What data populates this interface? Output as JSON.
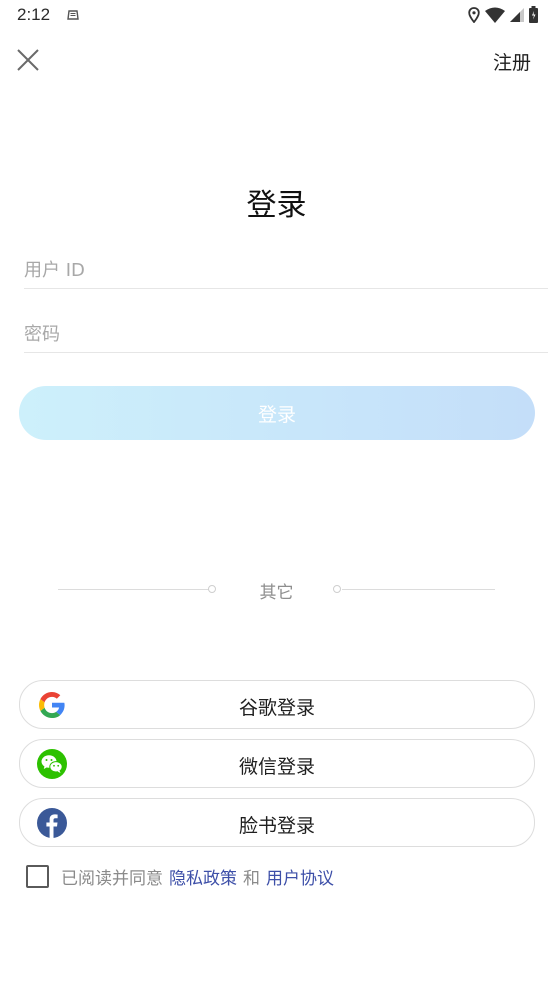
{
  "status_bar": {
    "time": "2:12",
    "icons": [
      "notification-icon",
      "location-icon",
      "wifi-icon",
      "signal-icon",
      "battery-icon"
    ]
  },
  "header": {
    "close_icon": "close-icon",
    "register_label": "注册"
  },
  "form": {
    "title": "登录",
    "userid_placeholder": "用户 ID",
    "userid_value": "",
    "password_placeholder": "密码",
    "password_value": "",
    "login_button_label": "登录"
  },
  "divider": {
    "label": "其它"
  },
  "social_logins": [
    {
      "label": "谷歌登录",
      "icon": "google-icon"
    },
    {
      "label": "微信登录",
      "icon": "wechat-icon"
    },
    {
      "label": "脸书登录",
      "icon": "facebook-icon"
    }
  ],
  "agreement": {
    "checked": false,
    "prefix": "已阅读并同意",
    "privacy_link": "隐私政策",
    "conjunction": "和",
    "terms_link": "用户协议"
  },
  "colors": {
    "login_gradient_start": "#cdf0fb",
    "login_gradient_end": "#c4def9",
    "link": "#3d4fa8",
    "wechat_green": "#2dc100",
    "facebook_blue": "#3b5998"
  }
}
